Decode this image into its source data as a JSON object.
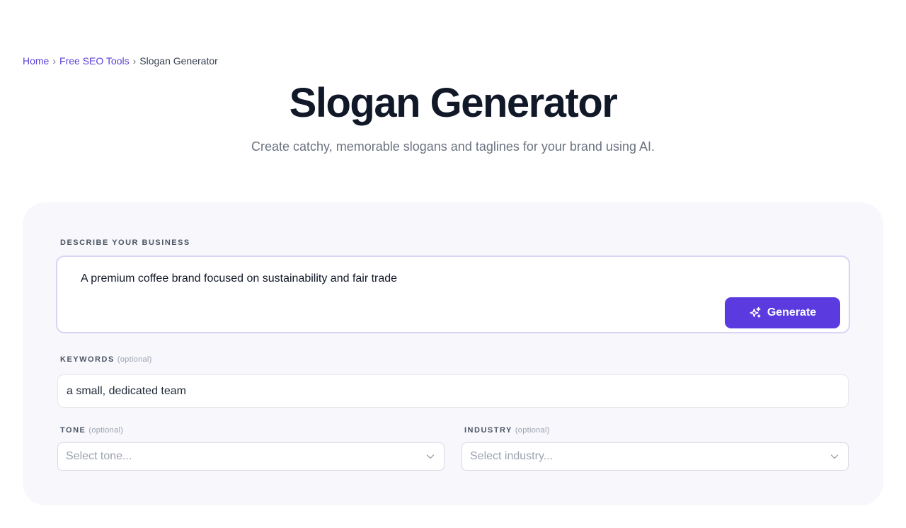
{
  "breadcrumb": {
    "home": "Home",
    "tools": "Free SEO Tools",
    "current": "Slogan Generator",
    "separator": "›"
  },
  "header": {
    "title": "Slogan Generator",
    "subtitle": "Create catchy, memorable slogans and taglines for your brand using AI."
  },
  "form": {
    "describe": {
      "label": "DESCRIBE YOUR BUSINESS",
      "value": "A premium coffee brand focused on sustainability and fair trade"
    },
    "generate_label": "Generate",
    "keywords": {
      "label": "KEYWORDS",
      "optional": "(optional)",
      "value": "a small, dedicated team"
    },
    "tone": {
      "label": "TONE",
      "optional": "(optional)",
      "placeholder": "Select tone..."
    },
    "industry": {
      "label": "INDUSTRY",
      "optional": "(optional)",
      "placeholder": "Select industry..."
    }
  },
  "colors": {
    "accent": "#5b3be0",
    "link": "#5b3fd6",
    "card_bg": "#f7f7fc"
  },
  "icons": {
    "generate": "sparkles-icon",
    "dropdown": "chevron-down-icon"
  }
}
